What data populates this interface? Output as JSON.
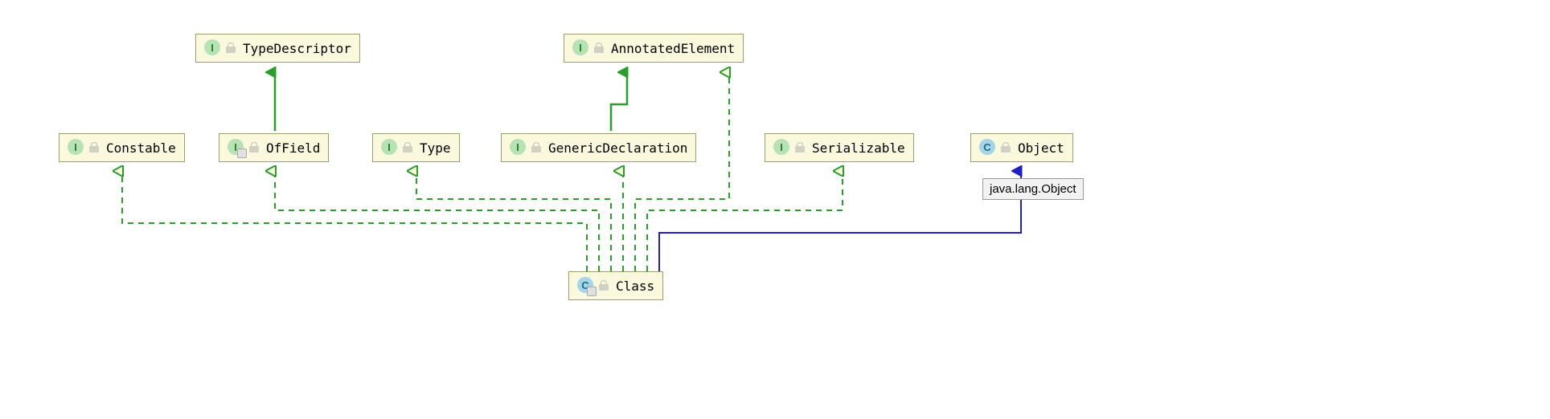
{
  "nodes": {
    "typeDescriptor": {
      "label": "TypeDescriptor",
      "type": "interface"
    },
    "annotatedElement": {
      "label": "AnnotatedElement",
      "type": "interface"
    },
    "constable": {
      "label": "Constable",
      "type": "interface"
    },
    "ofField": {
      "label": "OfField",
      "type": "interface"
    },
    "typeN": {
      "label": "Type",
      "type": "interface"
    },
    "genericDeclaration": {
      "label": "GenericDeclaration",
      "type": "interface"
    },
    "serializable": {
      "label": "Serializable",
      "type": "interface"
    },
    "objectN": {
      "label": "Object",
      "type": "class"
    },
    "classN": {
      "label": "Class",
      "type": "class"
    }
  },
  "tooltip": {
    "text": "java.lang.Object"
  },
  "chart_data": {
    "type": "class-diagram",
    "nodes": [
      {
        "id": "TypeDescriptor",
        "kind": "interface"
      },
      {
        "id": "AnnotatedElement",
        "kind": "interface"
      },
      {
        "id": "Constable",
        "kind": "interface"
      },
      {
        "id": "OfField",
        "kind": "interface"
      },
      {
        "id": "Type",
        "kind": "interface"
      },
      {
        "id": "GenericDeclaration",
        "kind": "interface"
      },
      {
        "id": "Serializable",
        "kind": "interface"
      },
      {
        "id": "Object",
        "kind": "class"
      },
      {
        "id": "Class",
        "kind": "class"
      }
    ],
    "edges": [
      {
        "from": "OfField",
        "to": "TypeDescriptor",
        "relation": "extends-solid"
      },
      {
        "from": "GenericDeclaration",
        "to": "AnnotatedElement",
        "relation": "extends-solid"
      },
      {
        "from": "Class",
        "to": "Constable",
        "relation": "implements-dashed"
      },
      {
        "from": "Class",
        "to": "OfField",
        "relation": "implements-dashed"
      },
      {
        "from": "Class",
        "to": "Type",
        "relation": "implements-dashed"
      },
      {
        "from": "Class",
        "to": "GenericDeclaration",
        "relation": "implements-dashed"
      },
      {
        "from": "Class",
        "to": "AnnotatedElement",
        "relation": "implements-dashed"
      },
      {
        "from": "Class",
        "to": "Serializable",
        "relation": "implements-dashed"
      },
      {
        "from": "Class",
        "to": "Object",
        "relation": "extends-solid-blue"
      }
    ]
  }
}
